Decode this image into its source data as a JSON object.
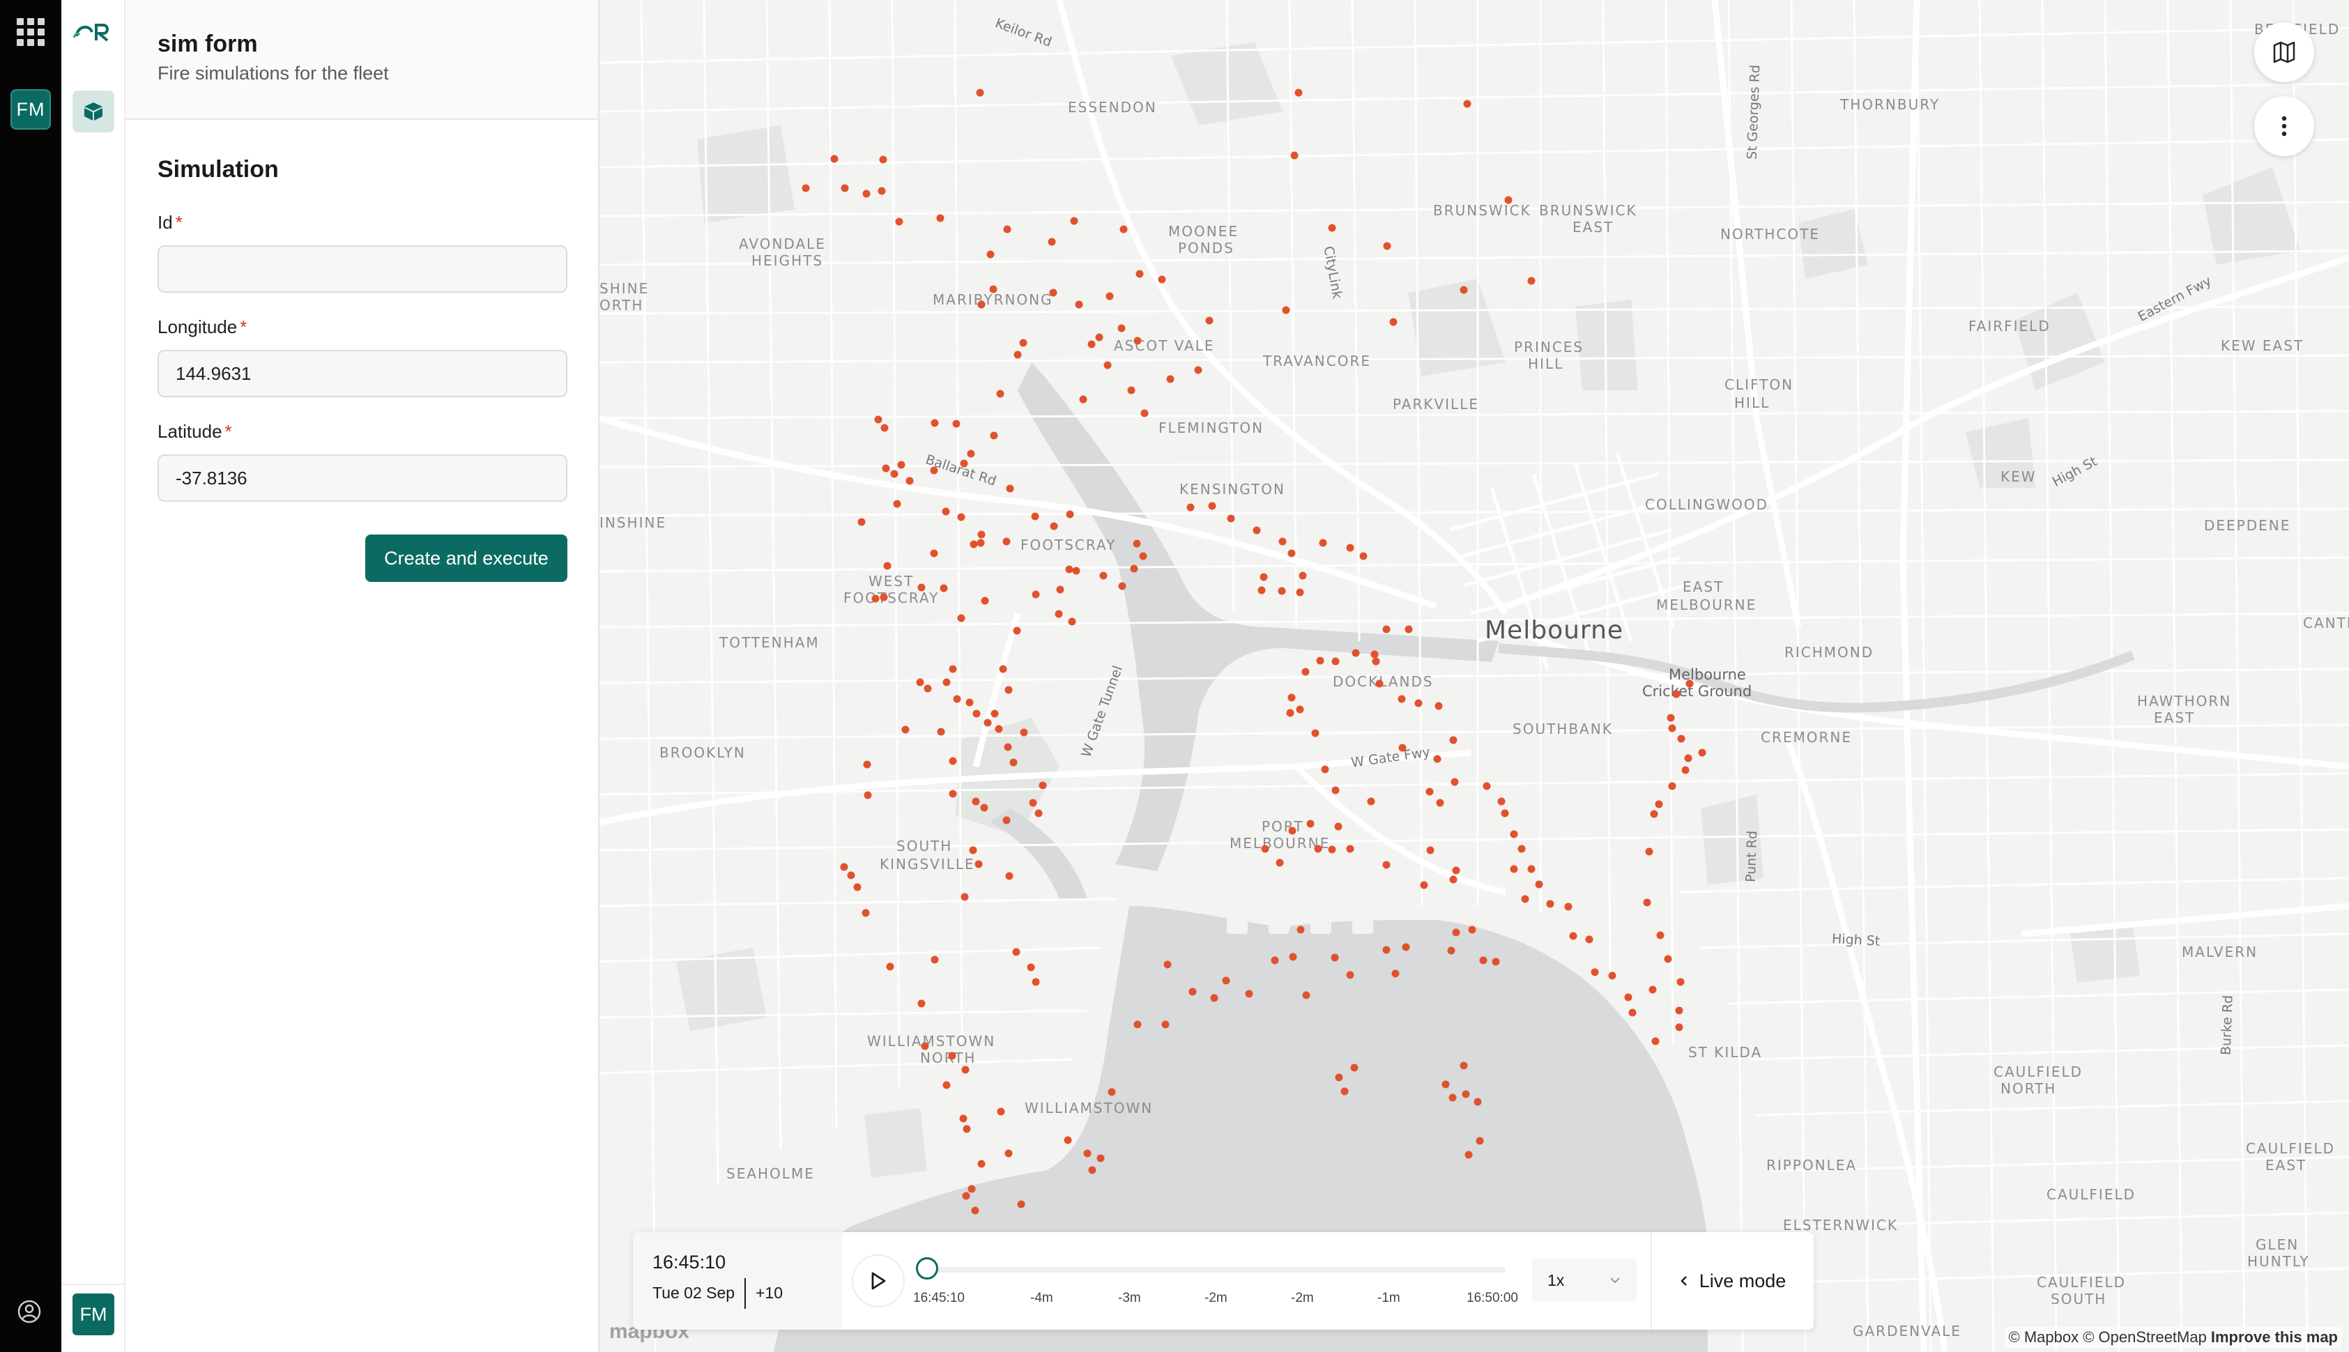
{
  "rail": {
    "badge_label": "FM"
  },
  "rail2": {
    "bottom_badge_label": "FM"
  },
  "panel": {
    "title": "sim form",
    "subtitle": "Fire simulations for the fleet",
    "section_title": "Simulation",
    "required_mark": "*",
    "fields": [
      {
        "label": "Id",
        "value": ""
      },
      {
        "label": "Longitude",
        "value": "144.9631"
      },
      {
        "label": "Latitude",
        "value": "-37.8136"
      }
    ],
    "submit_label": "Create and execute"
  },
  "map": {
    "labels": {
      "essendon": "ESSENDON",
      "avondale": "AVONDALE",
      "heights": "HEIGHTS",
      "moonee": "MOONEE",
      "ponds": "PONDS",
      "maribyrnong": "MARIBYRNONG",
      "ascot_vale": "ASCOT VALE",
      "travancore": "TRAVANCORE",
      "parkville": "PARKVILLE",
      "flemington": "FLEMINGTON",
      "kensington": "KENSINGTON",
      "footscray": "FOOTSCRAY",
      "west": "WEST",
      "west_footscray": "FOOTSCRAY",
      "tottenham": "TOTTENHAM",
      "brooklyn": "BROOKLYN",
      "south": "SOUTH",
      "kingsville": "KINGSVILLE",
      "williamstown_north": "WILLIAMSTOWN",
      "north": "NORTH",
      "williamstown": "WILLIAMSTOWN",
      "seaholme": "SEAHOLME",
      "docklands": "DOCKLANDS",
      "southbank": "SOUTHBANK",
      "port": "PORT",
      "melbourne_port": "MELBOURNE",
      "melbourne": "Melbourne",
      "brunswick": "BRUNSWICK",
      "brunswick_east": "BRUNSWICK",
      "east": "EAST",
      "northcote": "NORTHCOTE",
      "thornbury": "THORNBURY",
      "bellfield": "BELLFIELD",
      "fairfield": "FAIRFIELD",
      "kew_east": "KEW EAST",
      "princes": "PRINCES",
      "hill": "HILL",
      "clifton": "CLIFTON",
      "hill2": "HILL",
      "kew": "KEW",
      "collingwood": "COLLINGWOOD",
      "deepdene": "DEEPDENE",
      "east_melbourne_1": "EAST",
      "east_melbourne_2": "MELBOURNE",
      "richmond": "RICHMOND",
      "mcg_1": "Melbourne",
      "mcg_2": "Cricket Ground",
      "cremorne": "CREMORNE",
      "hawthorn": "HAWTHORN",
      "hawthorn_east": "EAST",
      "canter": "CANTER",
      "malvern": "MALVERN",
      "st_kilda": "ST KILDA",
      "caulfield_north": "CAULFIELD",
      "caulfield_north_2": "NORTH",
      "ripponlea": "RIPPONLEA",
      "caulfield": "CAULFIELD",
      "caulfield_east": "CAULFIELD",
      "caulfield_east_2": "EAST",
      "elsternwick": "ELSTERNWICK",
      "glen_huntly": "GLEN",
      "glen_huntly_2": "HUNTLY",
      "caulfield_south": "CAULFIELD",
      "caulfield_south_2": "SOUTH",
      "gardenvale": "GARDENVALE",
      "shine_1": "SHINE",
      "shine_2": "ORTH",
      "inshine": "INSHINE",
      "keilor_rd": "Keilor Rd",
      "ballarat_rd": "Ballarat Rd",
      "citylink": "CityLink",
      "st_georges_rd": "St Georges Rd",
      "eastern_fwy": "Eastern Fwy",
      "high_st": "High St",
      "high_st_2": "High St",
      "w_gate_tunnel": "W Gate Tunnel",
      "w_gate_fwy": "W Gate Fwy",
      "punt_rd": "Punt Rd",
      "burke_rd": "Burke Rd"
    },
    "attribution": "© Mapbox © OpenStreetMap",
    "improve_label": "Improve this map",
    "logo_label": "mapbox",
    "marker_color": "#e0522d",
    "water_color": "#d9dadb"
  },
  "timeline": {
    "current_time": "16:45:10",
    "date": "Tue 02 Sep",
    "timezone": "+10",
    "position_fraction": 0,
    "ticks": [
      "16:45:10",
      "-4m",
      "-3m",
      "-2m",
      "-2m",
      "-1m",
      "16:50:00"
    ],
    "speed": "1x",
    "live_label": "Live mode"
  }
}
